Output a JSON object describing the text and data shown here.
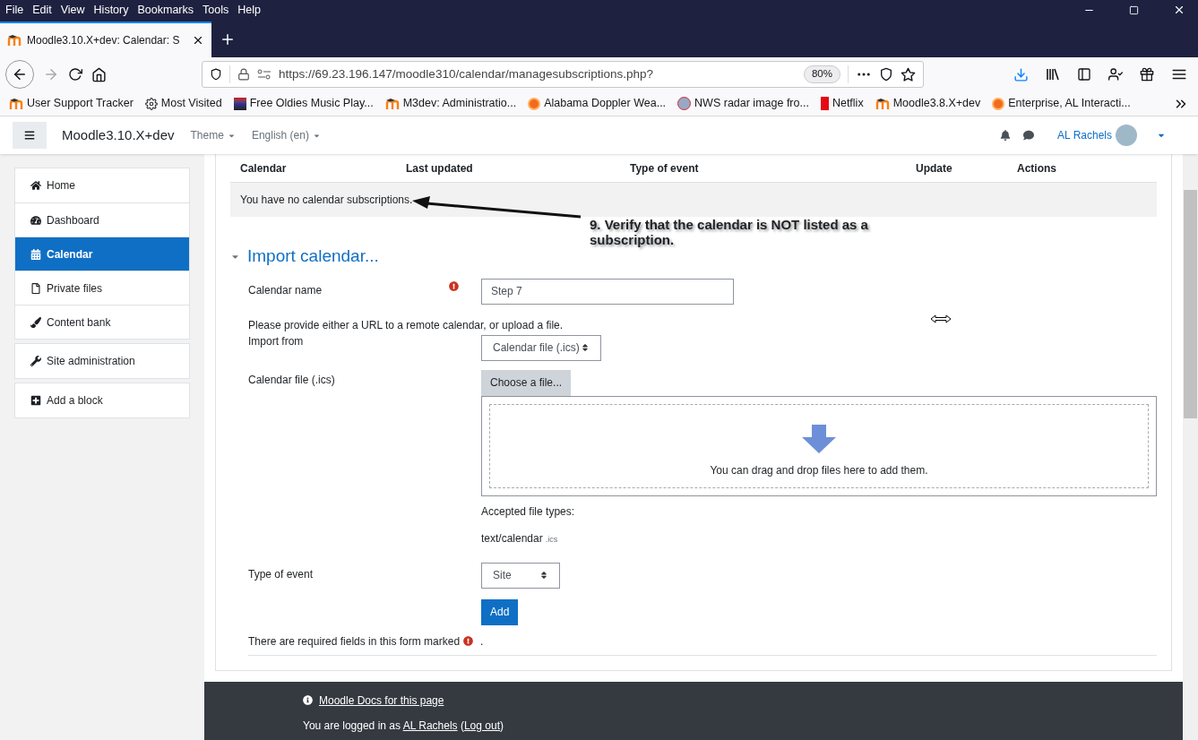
{
  "menu_bar": [
    "File",
    "Edit",
    "View",
    "History",
    "Bookmarks",
    "Tools",
    "Help"
  ],
  "tab": {
    "title": "Moodle3.10.X+dev: Calendar: S",
    "selected": true
  },
  "address_bar": {
    "url": "https://69.23.196.147/moodle310/calendar/managesubscriptions.php?",
    "zoom": "80%"
  },
  "bookmarks": [
    "User Support Tracker",
    "Most Visited",
    "Free Oldies Music Play...",
    "M3dev: Administratio...",
    "Alabama Doppler Wea...",
    "NWS radar image fro...",
    "Netflix",
    "Moodle3.8.X+dev",
    "Enterprise, AL Interacti..."
  ],
  "header": {
    "site_name": "Moodle3.10.X+dev",
    "menus": [
      "Theme",
      "English (en)"
    ],
    "user": "AL Rachels"
  },
  "sidebar": {
    "groups": [
      [
        {
          "label": "Home",
          "selected": false
        },
        {
          "label": "Dashboard",
          "selected": false
        },
        {
          "label": "Calendar",
          "selected": true
        },
        {
          "label": "Private files",
          "selected": false
        },
        {
          "label": "Content bank",
          "selected": false
        }
      ],
      [
        {
          "label": "Site administration",
          "selected": false
        }
      ],
      [
        {
          "label": "Add a block",
          "selected": false
        }
      ]
    ]
  },
  "subscriptions_table": {
    "columns": [
      "Calendar",
      "Last updated",
      "Type of event",
      "Update",
      "Actions"
    ],
    "empty_message": "You have no calendar subscriptions."
  },
  "annotation": "9. Verify that the calendar is NOT listed as a subscription.",
  "import_section": {
    "title": "Import calendar...",
    "expanded": true,
    "calendar_name": {
      "label": "Calendar name",
      "value": "Step 7",
      "required": true
    },
    "hint": "Please provide either a URL to a remote calendar, or upload a file.",
    "import_from": {
      "label": "Import from",
      "value": "Calendar file (.ics)"
    },
    "calendar_file": {
      "label": "Calendar file (.ics)",
      "button": "Choose a file...",
      "drop_text": "You can drag and drop files here to add them.",
      "accepted_label": "Accepted file types:",
      "accepted_type": "text/calendar",
      "accepted_ext": ".ics"
    },
    "type_of_event": {
      "label": "Type of event",
      "value": "Site"
    },
    "submit": "Add",
    "required_note": "There are required fields in this form marked",
    "required_note_end": "."
  },
  "footer": {
    "docs_link": "Moodle Docs for this page",
    "login_prefix": "You are logged in as ",
    "user": "AL Rachels",
    "paren_open": " (",
    "logout": "Log out",
    "paren_close": ")"
  }
}
